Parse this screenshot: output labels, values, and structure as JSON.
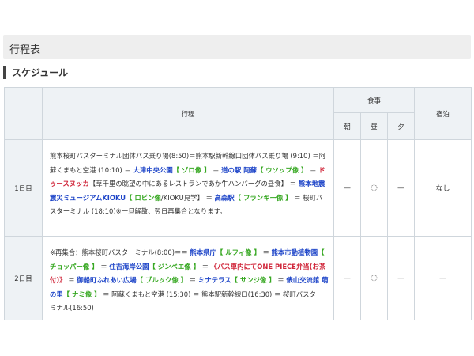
{
  "page": {
    "title": "行程表"
  },
  "section": {
    "title": "スケジュール"
  },
  "table": {
    "headers": {
      "route": "行程",
      "meals": "食事",
      "breakfast": "朝",
      "lunch": "昼",
      "dinner": "夕",
      "lodging": "宿泊"
    },
    "rows": [
      {
        "day": "1日目",
        "route": [
          {
            "t": "熊本桜町バスターミナル団体バス乗り場(8:50)＝熊本駅新幹線口団体バス乗り場 (9:10) ＝阿蘇くまもと空港 (10:10) ＝ "
          },
          {
            "t": "大津中央公園",
            "c": "blue"
          },
          {
            "t": "【 ゾロ像 】",
            "c": "green"
          },
          {
            "t": " ＝ "
          },
          {
            "t": "道の駅 阿蘇",
            "c": "blue"
          },
          {
            "t": "【 ウソップ像 】",
            "c": "green"
          },
          {
            "t": " ＝ "
          },
          {
            "t": "ドゥースヌッカ",
            "c": "red"
          },
          {
            "t": "【草千里の眺望の中にあるレストランであか牛ハンバーグの昼食】 ＝ "
          },
          {
            "t": "熊本地震震災ミュージアムKIOKU",
            "c": "blue"
          },
          {
            "t": "【 ロビン像",
            "c": "green"
          },
          {
            "t": "/KIOKU見学】 ＝ "
          },
          {
            "t": "高森駅",
            "c": "blue"
          },
          {
            "t": "【 フランキー像 】",
            "c": "green"
          },
          {
            "t": " ＝ 桜町バスターミナル (18:10)※一旦解散、翌日再集合となります。"
          }
        ],
        "breakfast": "—",
        "lunch": "◌",
        "dinner": "—",
        "lodging": "なし"
      },
      {
        "day": "2日目",
        "route": [
          {
            "t": "※再集合：熊本桜町バスターミナル(8:00)＝＝ "
          },
          {
            "t": "熊本県庁",
            "c": "blue"
          },
          {
            "t": "【 ルフィ像 】",
            "c": "green"
          },
          {
            "t": " ＝ "
          },
          {
            "t": "熊本市動植物園",
            "c": "blue"
          },
          {
            "t": "【 チョッパー像 】",
            "c": "green"
          },
          {
            "t": " ＝ "
          },
          {
            "t": "住吉海岸公園",
            "c": "blue"
          },
          {
            "t": "【 ジンベエ像 】",
            "c": "green"
          },
          {
            "t": " ＝ "
          },
          {
            "t": "《バス車内にてONE PIECE弁当(お茶付)》",
            "c": "red"
          },
          {
            "t": " ＝ "
          },
          {
            "t": "御船町ふれあい広場",
            "c": "blue"
          },
          {
            "t": "【 ブルック像 】",
            "c": "green"
          },
          {
            "t": " ＝ "
          },
          {
            "t": "ミナテラス",
            "c": "blue"
          },
          {
            "t": "【 サンジ像 】",
            "c": "green"
          },
          {
            "t": " ＝ "
          },
          {
            "t": "俵山交流館 萌の里",
            "c": "blue"
          },
          {
            "t": "【 ナミ像 】",
            "c": "green"
          },
          {
            "t": " ＝ 阿蘇くまもと空港 (15:30) ＝ 熊本駅新幹線口(16:30) ＝ 桜町バスターミナル(16:50)"
          }
        ],
        "breakfast": "—",
        "lunch": "◌",
        "dinner": "—",
        "lodging": "—"
      }
    ]
  }
}
